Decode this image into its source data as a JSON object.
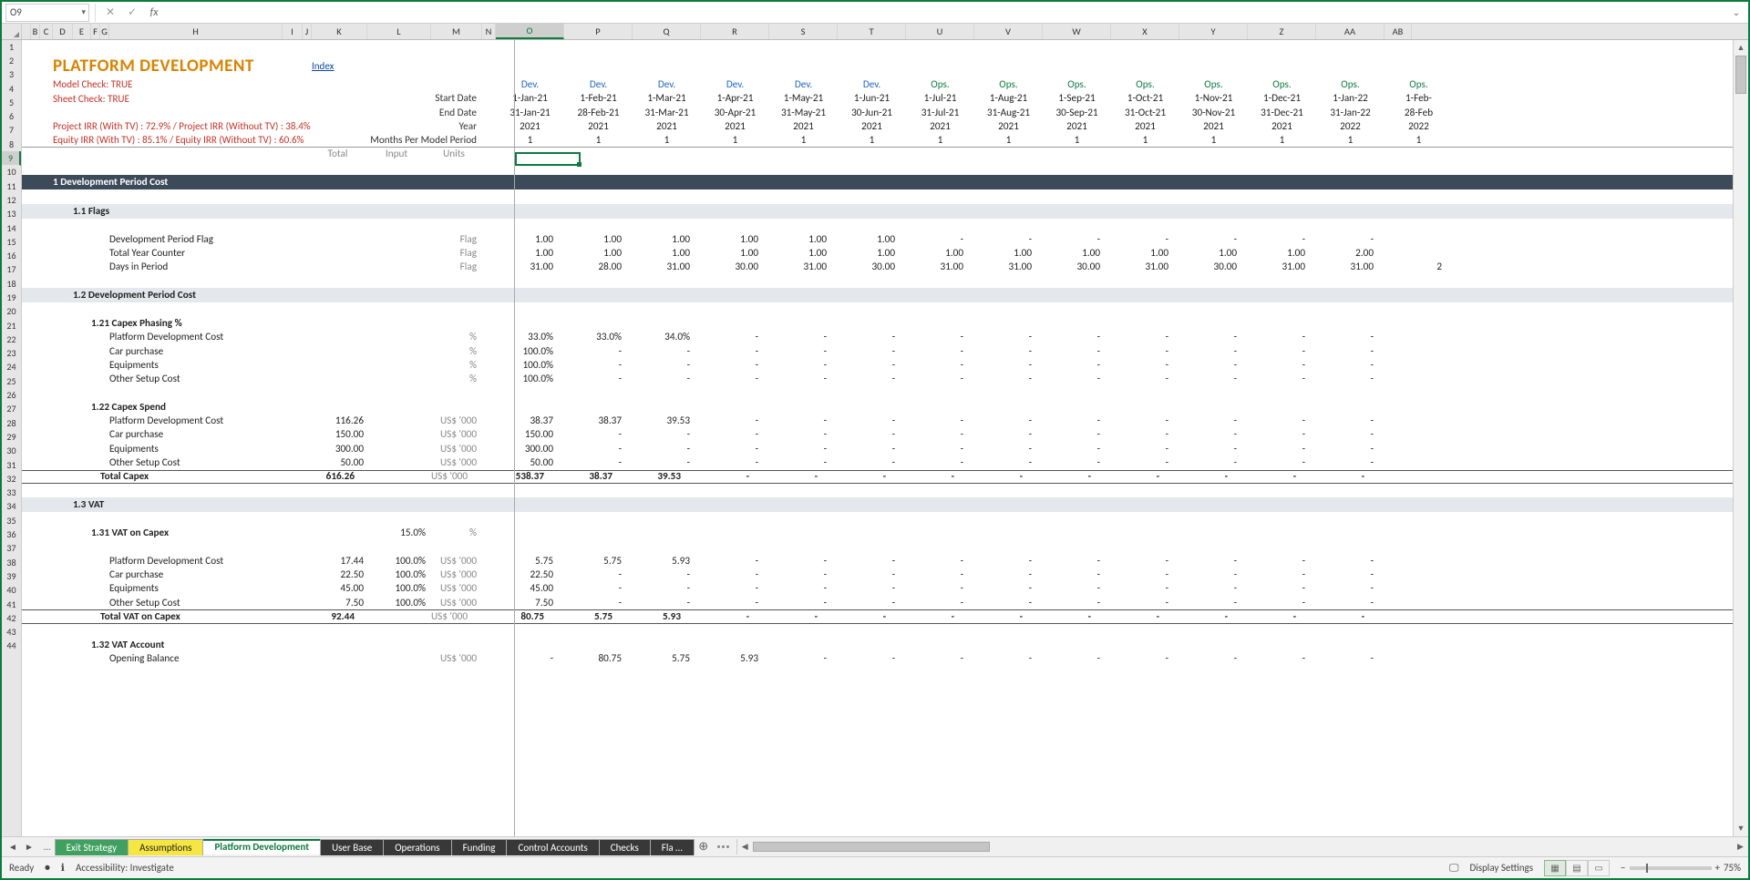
{
  "namebox": "O9",
  "columns": [
    "A",
    "B",
    "C",
    "D",
    "E",
    "F",
    "G",
    "H",
    "I",
    "J",
    "K",
    "L",
    "M",
    "N",
    "O",
    "P",
    "Q",
    "R",
    "S",
    "T",
    "U",
    "V",
    "W",
    "X",
    "Y",
    "Z",
    "AA",
    "AB"
  ],
  "header": {
    "title": "PLATFORM DEVELOPMENT",
    "index_link": "Index",
    "model_check": "Model Check: TRUE",
    "sheet_check": "Sheet Check: TRUE",
    "irr1": "Project IRR  (With TV) : 72.9%  / Project IRR (Without TV) : 38.4%",
    "irr2": "Equity IRR  (With TV) : 85.1%  / Equity IRR (Without TV) : 60.6%",
    "start_lbl": "Start Date",
    "end_lbl": "End Date",
    "year_lbl": "Year",
    "months_lbl": "Months Per Model Period",
    "total_lbl": "Total",
    "input_lbl": "Input",
    "units_lbl": "Units"
  },
  "periods": [
    {
      "phase": "Dev.",
      "start": "1-Jan-21",
      "end": "31-Jan-21",
      "year": "2021",
      "months": "1",
      "cls": "dev"
    },
    {
      "phase": "Dev.",
      "start": "1-Feb-21",
      "end": "28-Feb-21",
      "year": "2021",
      "months": "1",
      "cls": "dev"
    },
    {
      "phase": "Dev.",
      "start": "1-Mar-21",
      "end": "31-Mar-21",
      "year": "2021",
      "months": "1",
      "cls": "dev"
    },
    {
      "phase": "Dev.",
      "start": "1-Apr-21",
      "end": "30-Apr-21",
      "year": "2021",
      "months": "1",
      "cls": "dev"
    },
    {
      "phase": "Dev.",
      "start": "1-May-21",
      "end": "31-May-21",
      "year": "2021",
      "months": "1",
      "cls": "dev"
    },
    {
      "phase": "Dev.",
      "start": "1-Jun-21",
      "end": "30-Jun-21",
      "year": "2021",
      "months": "1",
      "cls": "dev"
    },
    {
      "phase": "Ops.",
      "start": "1-Jul-21",
      "end": "31-Jul-21",
      "year": "2021",
      "months": "1",
      "cls": "ops"
    },
    {
      "phase": "Ops.",
      "start": "1-Aug-21",
      "end": "31-Aug-21",
      "year": "2021",
      "months": "1",
      "cls": "ops"
    },
    {
      "phase": "Ops.",
      "start": "1-Sep-21",
      "end": "30-Sep-21",
      "year": "2021",
      "months": "1",
      "cls": "ops"
    },
    {
      "phase": "Ops.",
      "start": "1-Oct-21",
      "end": "31-Oct-21",
      "year": "2021",
      "months": "1",
      "cls": "ops"
    },
    {
      "phase": "Ops.",
      "start": "1-Nov-21",
      "end": "30-Nov-21",
      "year": "2021",
      "months": "1",
      "cls": "ops"
    },
    {
      "phase": "Ops.",
      "start": "1-Dec-21",
      "end": "31-Dec-21",
      "year": "2021",
      "months": "1",
      "cls": "ops"
    },
    {
      "phase": "Ops.",
      "start": "1-Jan-22",
      "end": "31-Jan-22",
      "year": "2022",
      "months": "1",
      "cls": "ops"
    },
    {
      "phase": "Ops.",
      "start": "1-Feb-",
      "end": "28-Feb",
      "year": "2022",
      "months": "1",
      "cls": "ops"
    }
  ],
  "section1": "1   Development Period Cost",
  "sec11": "1.1   Flags",
  "sec12": "1.2   Development Period Cost",
  "sec121": "1.21    Capex Phasing %",
  "sec122": "1.22    Capex Spend",
  "sec13": "1.3   VAT",
  "sec131": "1.31    VAT on Capex",
  "sec132": "1.32    VAT Account",
  "flags": [
    {
      "label": "Development Period Flag",
      "unit": "Flag",
      "vals": [
        "1.00",
        "1.00",
        "1.00",
        "1.00",
        "1.00",
        "1.00",
        "-",
        "-",
        "-",
        "-",
        "-",
        "-",
        "-",
        ""
      ]
    },
    {
      "label": "Total Year Counter",
      "unit": "Flag",
      "vals": [
        "1.00",
        "1.00",
        "1.00",
        "1.00",
        "1.00",
        "1.00",
        "1.00",
        "1.00",
        "1.00",
        "1.00",
        "1.00",
        "1.00",
        "2.00",
        ""
      ]
    },
    {
      "label": "Days in Period",
      "unit": "Flag",
      "vals": [
        "31.00",
        "28.00",
        "31.00",
        "30.00",
        "31.00",
        "30.00",
        "31.00",
        "31.00",
        "30.00",
        "31.00",
        "30.00",
        "31.00",
        "31.00",
        "2"
      ]
    }
  ],
  "phasing": [
    {
      "label": "Platform Development Cost",
      "unit": "%",
      "vals": [
        "33.0%",
        "33.0%",
        "34.0%",
        "-",
        "-",
        "-",
        "-",
        "-",
        "-",
        "-",
        "-",
        "-",
        "-",
        ""
      ]
    },
    {
      "label": "Car purchase",
      "unit": "%",
      "vals": [
        "100.0%",
        "-",
        "-",
        "-",
        "-",
        "-",
        "-",
        "-",
        "-",
        "-",
        "-",
        "-",
        "-",
        ""
      ]
    },
    {
      "label": "Equipments",
      "unit": "%",
      "vals": [
        "100.0%",
        "-",
        "-",
        "-",
        "-",
        "-",
        "-",
        "-",
        "-",
        "-",
        "-",
        "-",
        "-",
        ""
      ]
    },
    {
      "label": "Other Setup Cost",
      "unit": "%",
      "vals": [
        "100.0%",
        "-",
        "-",
        "-",
        "-",
        "-",
        "-",
        "-",
        "-",
        "-",
        "-",
        "-",
        "-",
        ""
      ]
    }
  ],
  "spend": [
    {
      "label": "Platform Development Cost",
      "k": "116.26",
      "unit": "US$ '000",
      "vals": [
        "38.37",
        "38.37",
        "39.53",
        "-",
        "-",
        "-",
        "-",
        "-",
        "-",
        "-",
        "-",
        "-",
        "-",
        ""
      ]
    },
    {
      "label": "Car purchase",
      "k": "150.00",
      "unit": "US$ '000",
      "vals": [
        "150.00",
        "-",
        "-",
        "-",
        "-",
        "-",
        "-",
        "-",
        "-",
        "-",
        "-",
        "-",
        "-",
        ""
      ]
    },
    {
      "label": "Equipments",
      "k": "300.00",
      "unit": "US$ '000",
      "vals": [
        "300.00",
        "-",
        "-",
        "-",
        "-",
        "-",
        "-",
        "-",
        "-",
        "-",
        "-",
        "-",
        "-",
        ""
      ]
    },
    {
      "label": "Other Setup Cost",
      "k": "50.00",
      "unit": "US$ '000",
      "vals": [
        "50.00",
        "-",
        "-",
        "-",
        "-",
        "-",
        "-",
        "-",
        "-",
        "-",
        "-",
        "-",
        "-",
        ""
      ]
    }
  ],
  "spend_total": {
    "label": "Total Capex",
    "k": "616.26",
    "unit": "US$ '000",
    "vals": [
      "538.37",
      "38.37",
      "39.53",
      "-",
      "-",
      "-",
      "-",
      "-",
      "-",
      "-",
      "-",
      "-",
      "-",
      ""
    ]
  },
  "vat_rate": {
    "label": "VAT on Capex",
    "input": "15.0%",
    "unit": "%"
  },
  "vat_lines": [
    {
      "label": "Platform Development Cost",
      "k": "17.44",
      "l": "100.0%",
      "unit": "US$ '000",
      "vals": [
        "5.75",
        "5.75",
        "5.93",
        "-",
        "-",
        "-",
        "-",
        "-",
        "-",
        "-",
        "-",
        "-",
        "-",
        ""
      ]
    },
    {
      "label": "Car purchase",
      "k": "22.50",
      "l": "100.0%",
      "unit": "US$ '000",
      "vals": [
        "22.50",
        "-",
        "-",
        "-",
        "-",
        "-",
        "-",
        "-",
        "-",
        "-",
        "-",
        "-",
        "-",
        ""
      ]
    },
    {
      "label": "Equipments",
      "k": "45.00",
      "l": "100.0%",
      "unit": "US$ '000",
      "vals": [
        "45.00",
        "-",
        "-",
        "-",
        "-",
        "-",
        "-",
        "-",
        "-",
        "-",
        "-",
        "-",
        "-",
        ""
      ]
    },
    {
      "label": "Other Setup Cost",
      "k": "7.50",
      "l": "100.0%",
      "unit": "US$ '000",
      "vals": [
        "7.50",
        "-",
        "-",
        "-",
        "-",
        "-",
        "-",
        "-",
        "-",
        "-",
        "-",
        "-",
        "-",
        ""
      ]
    }
  ],
  "vat_total": {
    "label": "Total VAT on Capex",
    "k": "92.44",
    "unit": "US$ '000",
    "vals": [
      "80.75",
      "5.75",
      "5.93",
      "-",
      "-",
      "-",
      "-",
      "-",
      "-",
      "-",
      "-",
      "-",
      "-",
      ""
    ]
  },
  "vat_acct": {
    "label": "Opening Balance",
    "unit": "US$ '000",
    "vals": [
      "-",
      "80.75",
      "5.75",
      "5.93",
      "-",
      "-",
      "-",
      "-",
      "-",
      "-",
      "-",
      "-",
      "-",
      ""
    ]
  },
  "tabs": [
    "Exit Strategy",
    "Assumptions",
    "Platform Development",
    "User Base",
    "Operations",
    "Funding",
    "Control Accounts",
    "Checks",
    "Fla …"
  ],
  "status": {
    "ready": "Ready",
    "accessibility": "Accessibility: Investigate",
    "display": "Display Settings",
    "zoom": "75%"
  }
}
